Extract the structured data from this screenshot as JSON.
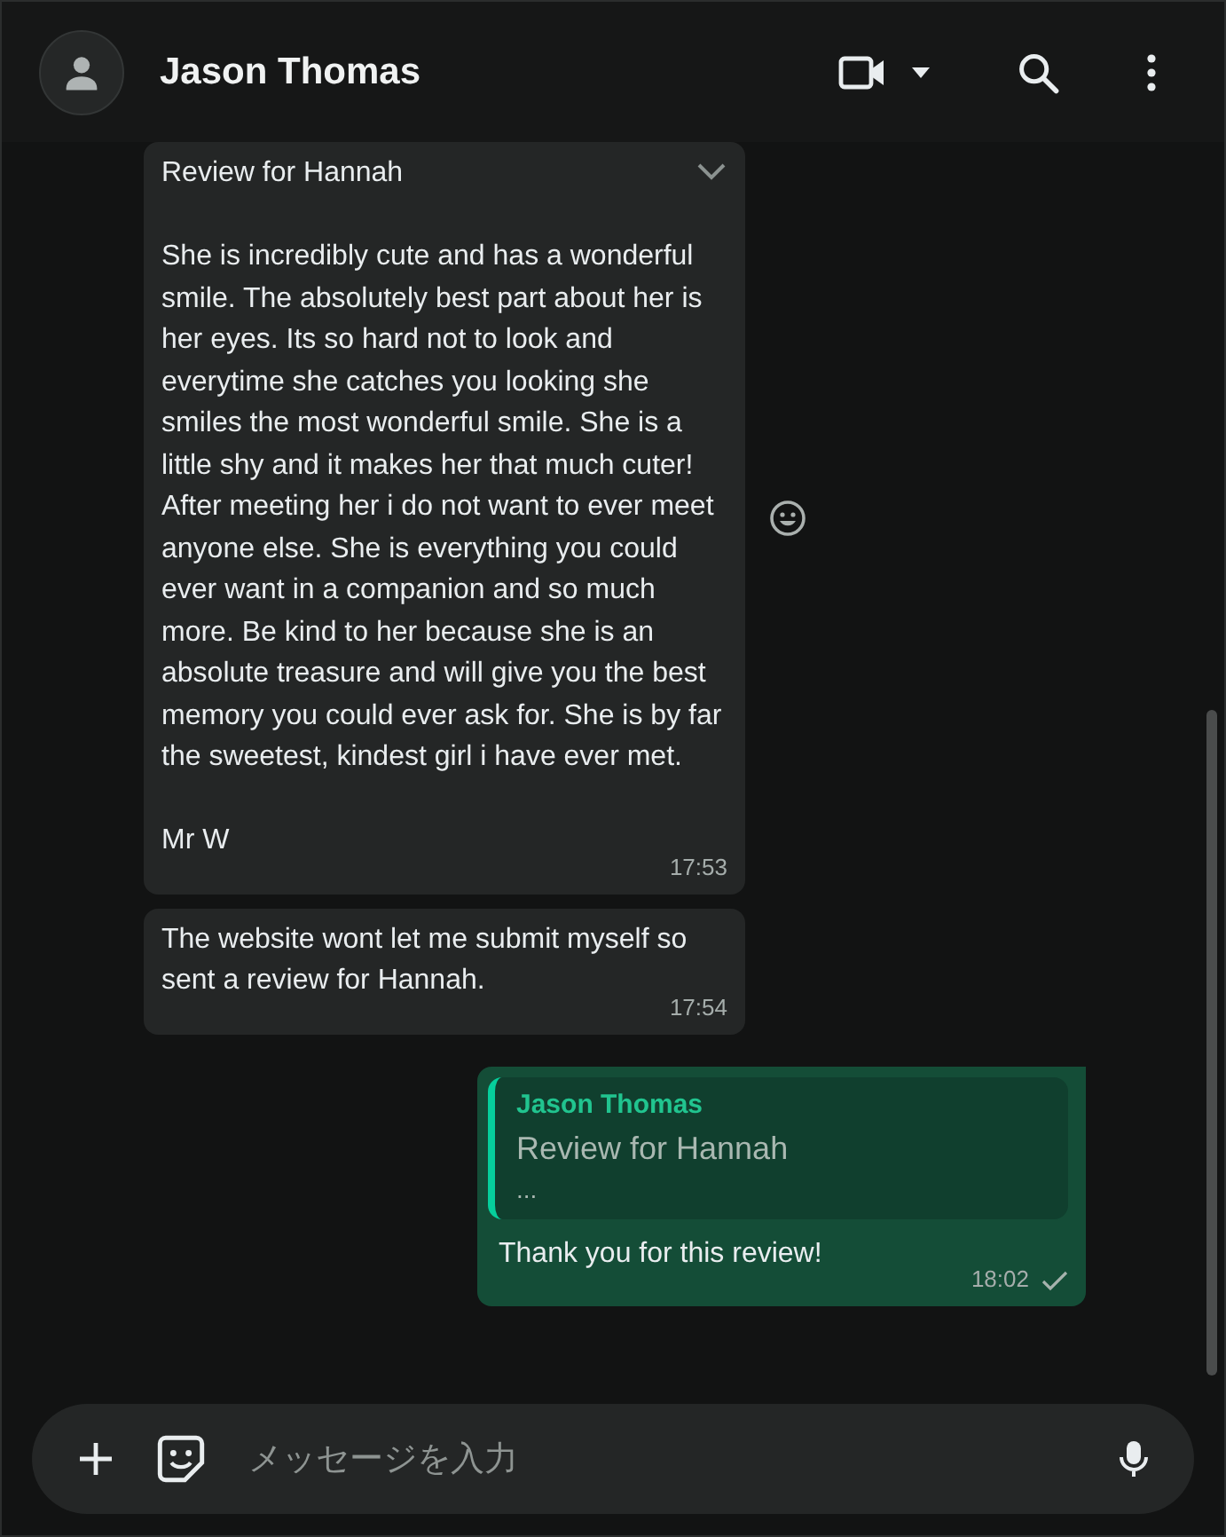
{
  "header": {
    "contact_name": "Jason Thomas"
  },
  "messages": [
    {
      "kind": "incoming",
      "hovered": true,
      "paragraphs": [
        "Review for Hannah",
        "She is incredibly cute and has a wonderful smile. The absolutely best part about her is her eyes. Its so hard not to look and everytime she catches you looking she smiles the most wonderful smile. She is a little shy and it makes her that much cuter! After meeting her i do not want to ever meet anyone else. She is everything you could ever want in a companion and so much more. Be kind to her because she is an absolute treasure and will give you the best memory you could ever ask for. She is by far the sweetest, kindest girl i have ever met.",
        "Mr W"
      ],
      "time": "17:53"
    },
    {
      "kind": "incoming",
      "hovered": false,
      "paragraphs": [
        "The website wont let me submit myself so sent a review for Hannah."
      ],
      "time": "17:54"
    },
    {
      "kind": "outgoing",
      "hovered": false,
      "quote": {
        "author": "Jason Thomas",
        "title": "Review for Hannah",
        "more": "..."
      },
      "paragraphs": [
        "Thank you for this review!"
      ],
      "time": "18:02",
      "delivered": false
    }
  ],
  "composer": {
    "placeholder": "メッセージを入力"
  }
}
